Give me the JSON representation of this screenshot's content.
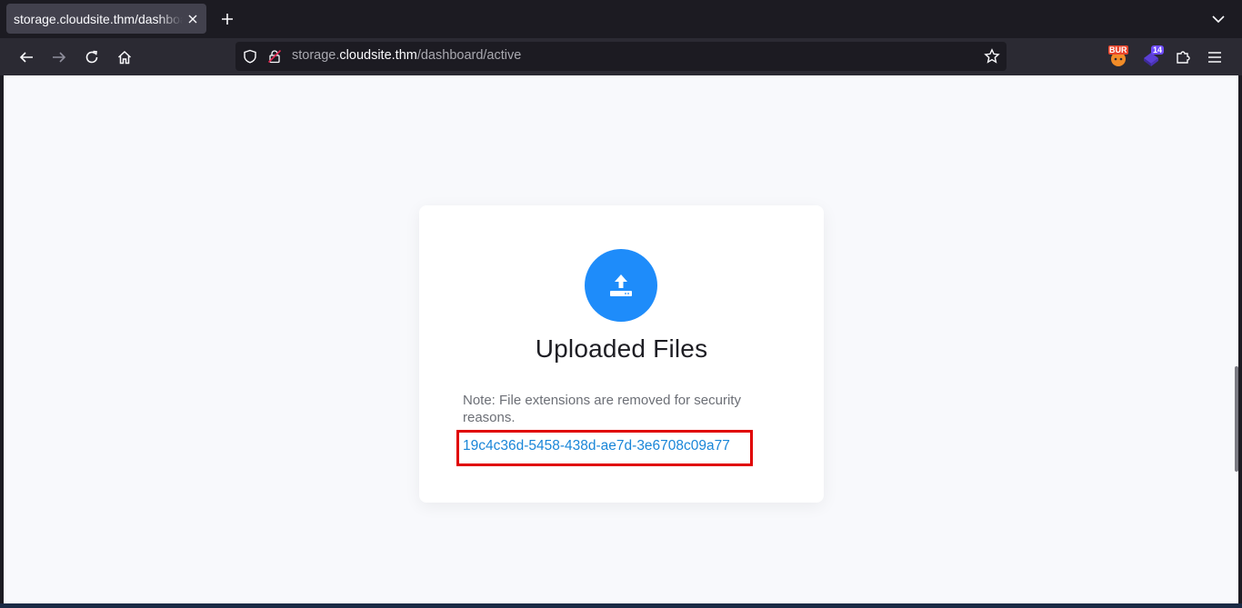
{
  "browser": {
    "tab_title": "storage.cloudsite.thm/dashboard/active",
    "url": {
      "prefix": "storage.",
      "host": "cloudsite.thm",
      "path": "/dashboard/active"
    },
    "extensions": {
      "burp_badge": "BUR",
      "count_badge": "14"
    },
    "icons": {
      "back": "arrow-left-icon",
      "forward": "arrow-right-icon",
      "reload": "reload-icon",
      "home": "home-icon",
      "shield": "shield-icon",
      "lock": "lock-icon",
      "star": "star-icon",
      "extensions": "puzzle-icon",
      "menu": "hamburger-icon"
    }
  },
  "page": {
    "title": "Uploaded Files",
    "note": "Note: File extensions are removed for security reasons.",
    "files": [
      {
        "name": "19c4c36d-5458-438d-ae7d-3e6708c09a77"
      }
    ],
    "colors": {
      "accent": "#1e8cfa",
      "link": "#1a86d8",
      "highlight": "#e00000"
    }
  }
}
